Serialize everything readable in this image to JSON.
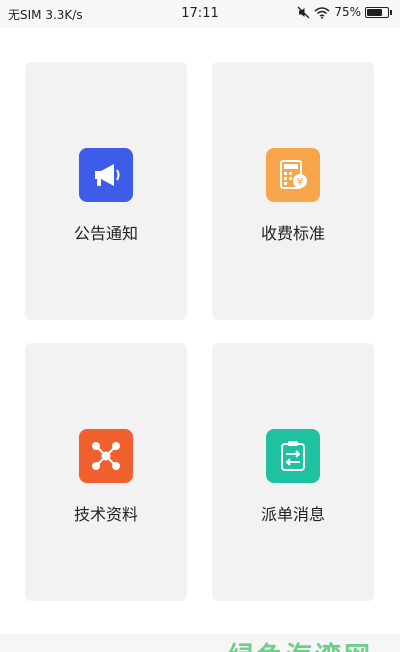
{
  "status_bar": {
    "carrier": "无SIM",
    "net_speed": "3.3K/s",
    "time": "17:11",
    "battery_percent": "75%",
    "battery_level": 0.75,
    "icons": [
      "mute-icon",
      "wifi-icon",
      "battery-icon"
    ]
  },
  "cards": [
    {
      "label": "公告通知",
      "icon": "megaphone-icon",
      "color": "#3d5ce8"
    },
    {
      "label": "收费标准",
      "icon": "calculator-yen-icon",
      "color": "#f6a54a"
    },
    {
      "label": "技术资料",
      "icon": "network-nodes-icon",
      "color": "#f0602e"
    },
    {
      "label": "派单消息",
      "icon": "clipboard-transfer-icon",
      "color": "#1ec2a0"
    }
  ],
  "bottom_banner": {
    "text": "绿色海湾网"
  }
}
